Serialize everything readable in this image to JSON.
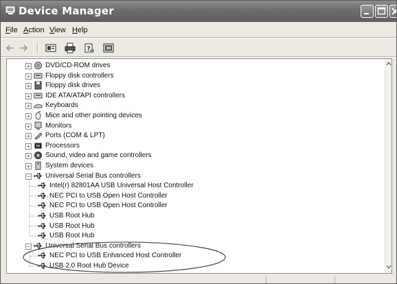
{
  "window": {
    "title": "Device Manager"
  },
  "menu": [
    "File",
    "Action",
    "View",
    "Help"
  ],
  "menu_mnemonics": [
    "F",
    "A",
    "V",
    "H"
  ],
  "toolbar": [
    {
      "name": "back-arrow-icon"
    },
    {
      "name": "forward-arrow-icon"
    },
    {
      "name": "properties-icon"
    },
    {
      "name": "print-icon"
    },
    {
      "name": "help-icon"
    },
    {
      "name": "view-icon"
    }
  ],
  "tree": {
    "items": [
      {
        "label": "DVD/CD-ROM drives",
        "icon": "dvd-drive-icon",
        "level": 0,
        "expanded": false
      },
      {
        "label": "Floppy disk controllers",
        "icon": "floppy-controller-icon",
        "level": 0,
        "expanded": false
      },
      {
        "label": "Floppy disk drives",
        "icon": "floppy-drive-icon",
        "level": 0,
        "expanded": false
      },
      {
        "label": "IDE ATA/ATAPI controllers",
        "icon": "ide-controller-icon",
        "level": 0,
        "expanded": false
      },
      {
        "label": "Keyboards",
        "icon": "keyboard-icon",
        "level": 0,
        "expanded": false
      },
      {
        "label": "Mice and other pointing devices",
        "icon": "mouse-icon",
        "level": 0,
        "expanded": false
      },
      {
        "label": "Monitors",
        "icon": "monitor-icon",
        "level": 0,
        "expanded": false
      },
      {
        "label": "Ports (COM & LPT)",
        "icon": "port-icon",
        "level": 0,
        "expanded": false
      },
      {
        "label": "Processors",
        "icon": "processor-icon",
        "level": 0,
        "expanded": false
      },
      {
        "label": "Sound, video and game controllers",
        "icon": "sound-icon",
        "level": 0,
        "expanded": false
      },
      {
        "label": "System devices",
        "icon": "system-devices-icon",
        "level": 0,
        "expanded": false
      },
      {
        "label": "Universal Serial Bus controllers",
        "icon": "usb-icon",
        "level": 0,
        "expanded": true
      },
      {
        "label": "Intel(r) 82801AA USB Universal Host Controller",
        "icon": "usb-icon",
        "level": 1
      },
      {
        "label": "NEC PCI to USB Open Host Controller",
        "icon": "usb-icon",
        "level": 1
      },
      {
        "label": "NEC PCI to USB Open Host Controller",
        "icon": "usb-icon",
        "level": 1
      },
      {
        "label": "USB Root Hub",
        "icon": "usb-icon",
        "level": 1
      },
      {
        "label": "USB Root Hub",
        "icon": "usb-icon",
        "level": 1
      },
      {
        "label": "USB Root Hub",
        "icon": "usb-icon",
        "level": 1
      },
      {
        "label": "Universal Serial Bus controllers",
        "icon": "usb-icon",
        "level": 0,
        "expanded": true
      },
      {
        "label": "NEC PCI to USB Enhanced Host Controller",
        "icon": "usb-icon",
        "level": 1
      },
      {
        "label": "USB 2.0 Root Hub Device",
        "icon": "usb-icon",
        "level": 1
      }
    ]
  },
  "colors": {
    "titlebar": "#6c6c6c",
    "window_bg": "#ece9e2",
    "tree_bg": "#ffffff",
    "annotation": "#555555"
  }
}
